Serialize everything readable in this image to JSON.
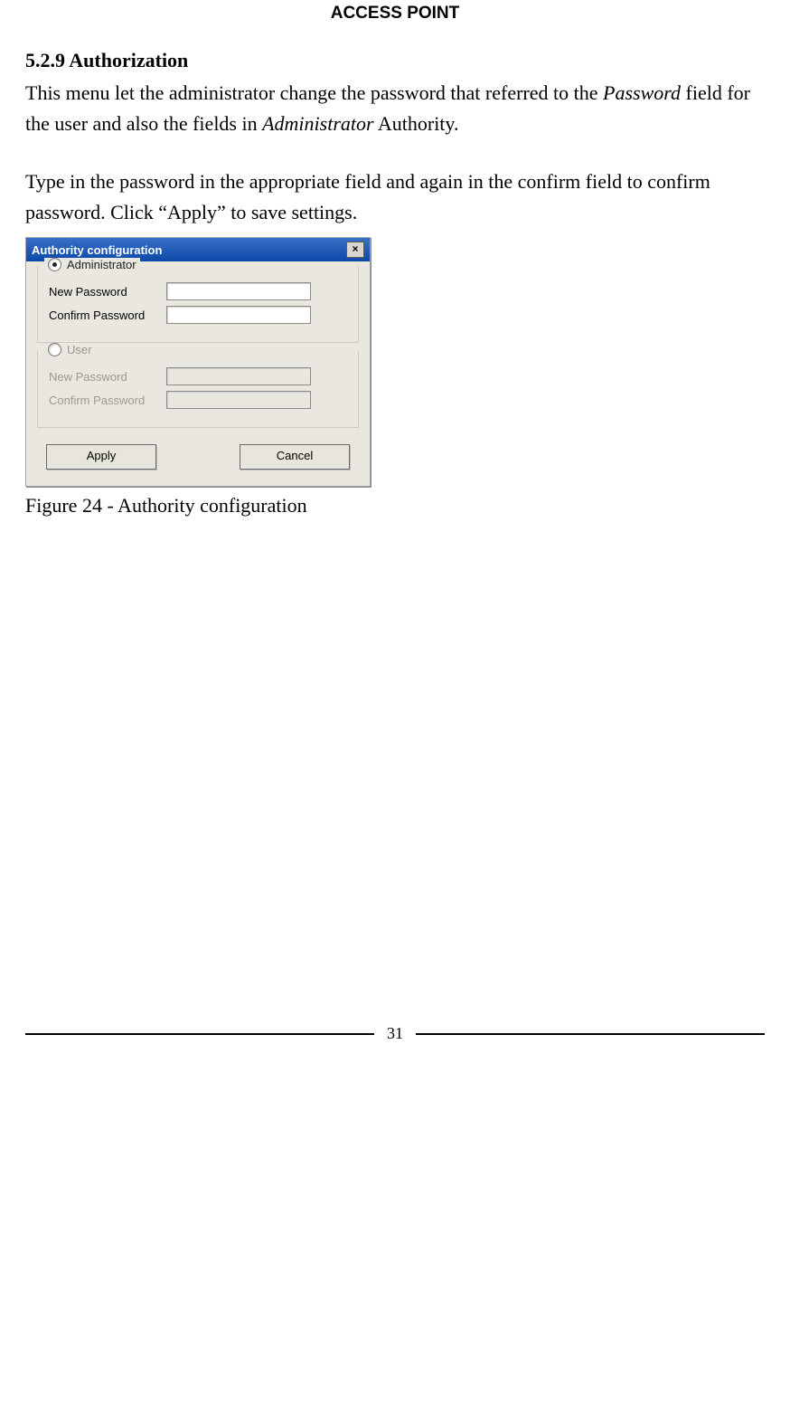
{
  "header": {
    "title": "ACCESS POINT"
  },
  "section": {
    "heading": "5.2.9 Authorization",
    "p1_a": "This menu let the administrator change the password that referred to the ",
    "p1_i1": "Password",
    "p1_b": " field for the user and also the fields in ",
    "p1_i2": "Administrator",
    "p1_c": " Authority.",
    "p2_a": "Type in the password in the appropriate field and again in the confirm field to confirm password. Click “",
    "p2_i1": "Apply”",
    "p2_b": " to save settings."
  },
  "dialog": {
    "title": "Authority configuration",
    "close": "×",
    "admin": {
      "legend": "Administrator",
      "new_pw": "New Password",
      "confirm_pw": "Confirm Password"
    },
    "user": {
      "legend": "User",
      "new_pw": "New Password",
      "confirm_pw": "Confirm Password"
    },
    "apply": "Apply",
    "cancel": "Cancel"
  },
  "caption": "Figure 24 - Authority configuration",
  "footer": {
    "page": "31"
  }
}
